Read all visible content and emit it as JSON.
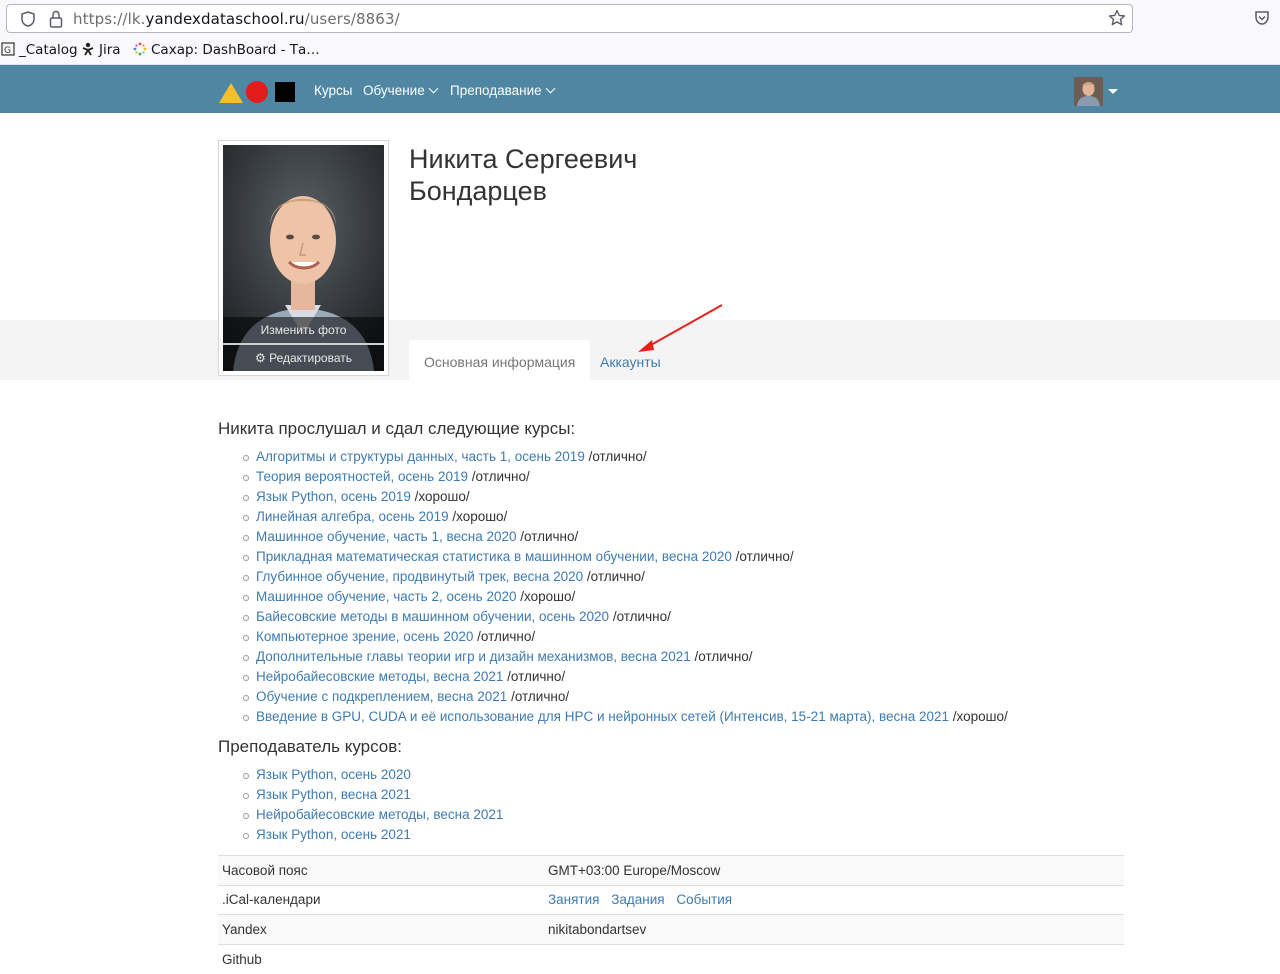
{
  "browser": {
    "url_prefix": "https://lk.",
    "url_domain": "yandexdataschool.ru",
    "url_path": "/users/8863/",
    "bookmarks": [
      {
        "label": "_Catalog",
        "icon": "catalog-icon"
      },
      {
        "label": "Jira",
        "icon": "jira-icon"
      },
      {
        "label": "Сахар: DashBoard - Та…",
        "icon": "dashboard-icon"
      }
    ]
  },
  "nav": {
    "items": [
      {
        "label": "Курсы",
        "has_dropdown": false
      },
      {
        "label": "Обучение",
        "has_dropdown": true
      },
      {
        "label": "Преподавание",
        "has_dropdown": true
      }
    ],
    "colors": {
      "bar": "#4f87a3",
      "triangle": "#f6bf27",
      "circle": "#e21b1b",
      "square": "#000000"
    }
  },
  "profile": {
    "name_line1": "Никита Сергеевич",
    "name_line2": "Бондарцев",
    "change_photo": "Изменить фото",
    "edit": "Редактировать",
    "tabs": [
      {
        "label": "Основная информация",
        "active": true
      },
      {
        "label": "Аккаунты",
        "active": false
      }
    ]
  },
  "completed_courses": {
    "title": "Никита прослушал и сдал следующие курсы:",
    "items": [
      {
        "course": "Алгоритмы и структуры данных, часть 1, осень 2019",
        "grade": " /отлично/"
      },
      {
        "course": "Теория вероятностей, осень 2019",
        "grade": " /отлично/"
      },
      {
        "course": "Язык Python, осень 2019",
        "grade": " /хорошо/"
      },
      {
        "course": "Линейная алгебра, осень 2019",
        "grade": " /хорошо/"
      },
      {
        "course": "Машинное обучение, часть 1, весна 2020",
        "grade": " /отлично/"
      },
      {
        "course": "Прикладная математическая статистика в машинном обучении, весна 2020",
        "grade": " /отлично/"
      },
      {
        "course": "Глубинное обучение, продвинутый трек, весна 2020",
        "grade": " /отлично/"
      },
      {
        "course": "Машинное обучение, часть 2, осень 2020",
        "grade": " /хорошо/"
      },
      {
        "course": "Байесовские методы в машинном обучении, осень 2020",
        "grade": " /отлично/"
      },
      {
        "course": "Компьютерное зрение, осень 2020",
        "grade": " /отлично/"
      },
      {
        "course": "Дополнительные главы теории игр и дизайн механизмов, весна 2021",
        "grade": " /отлично/"
      },
      {
        "course": "Нейробайесовские методы, весна 2021",
        "grade": " /отлично/"
      },
      {
        "course": "Обучение с подкреплением, весна 2021",
        "grade": " /отлично/"
      },
      {
        "course": "Введение в GPU, CUDA и её использование для HPC и нейронных сетей (Интенсив, 15-21 марта), весна 2021",
        "grade": " /хорошо/"
      }
    ]
  },
  "teaching": {
    "title": "Преподаватель курсов:",
    "items": [
      "Язык Python, осень 2020",
      "Язык Python, весна 2021",
      "Нейробайесовские методы, весна 2021",
      "Язык Python, осень 2021"
    ]
  },
  "info_table": {
    "timezone_label": "Часовой пояс",
    "timezone_value": "GMT+03:00 Europe/Moscow",
    "ical_label": ".iCal-календари",
    "ical_links": [
      "Занятия",
      "Задания",
      "События"
    ],
    "yandex_label": "Yandex",
    "yandex_value": "nikitabondartsev",
    "github_label": "Github"
  }
}
